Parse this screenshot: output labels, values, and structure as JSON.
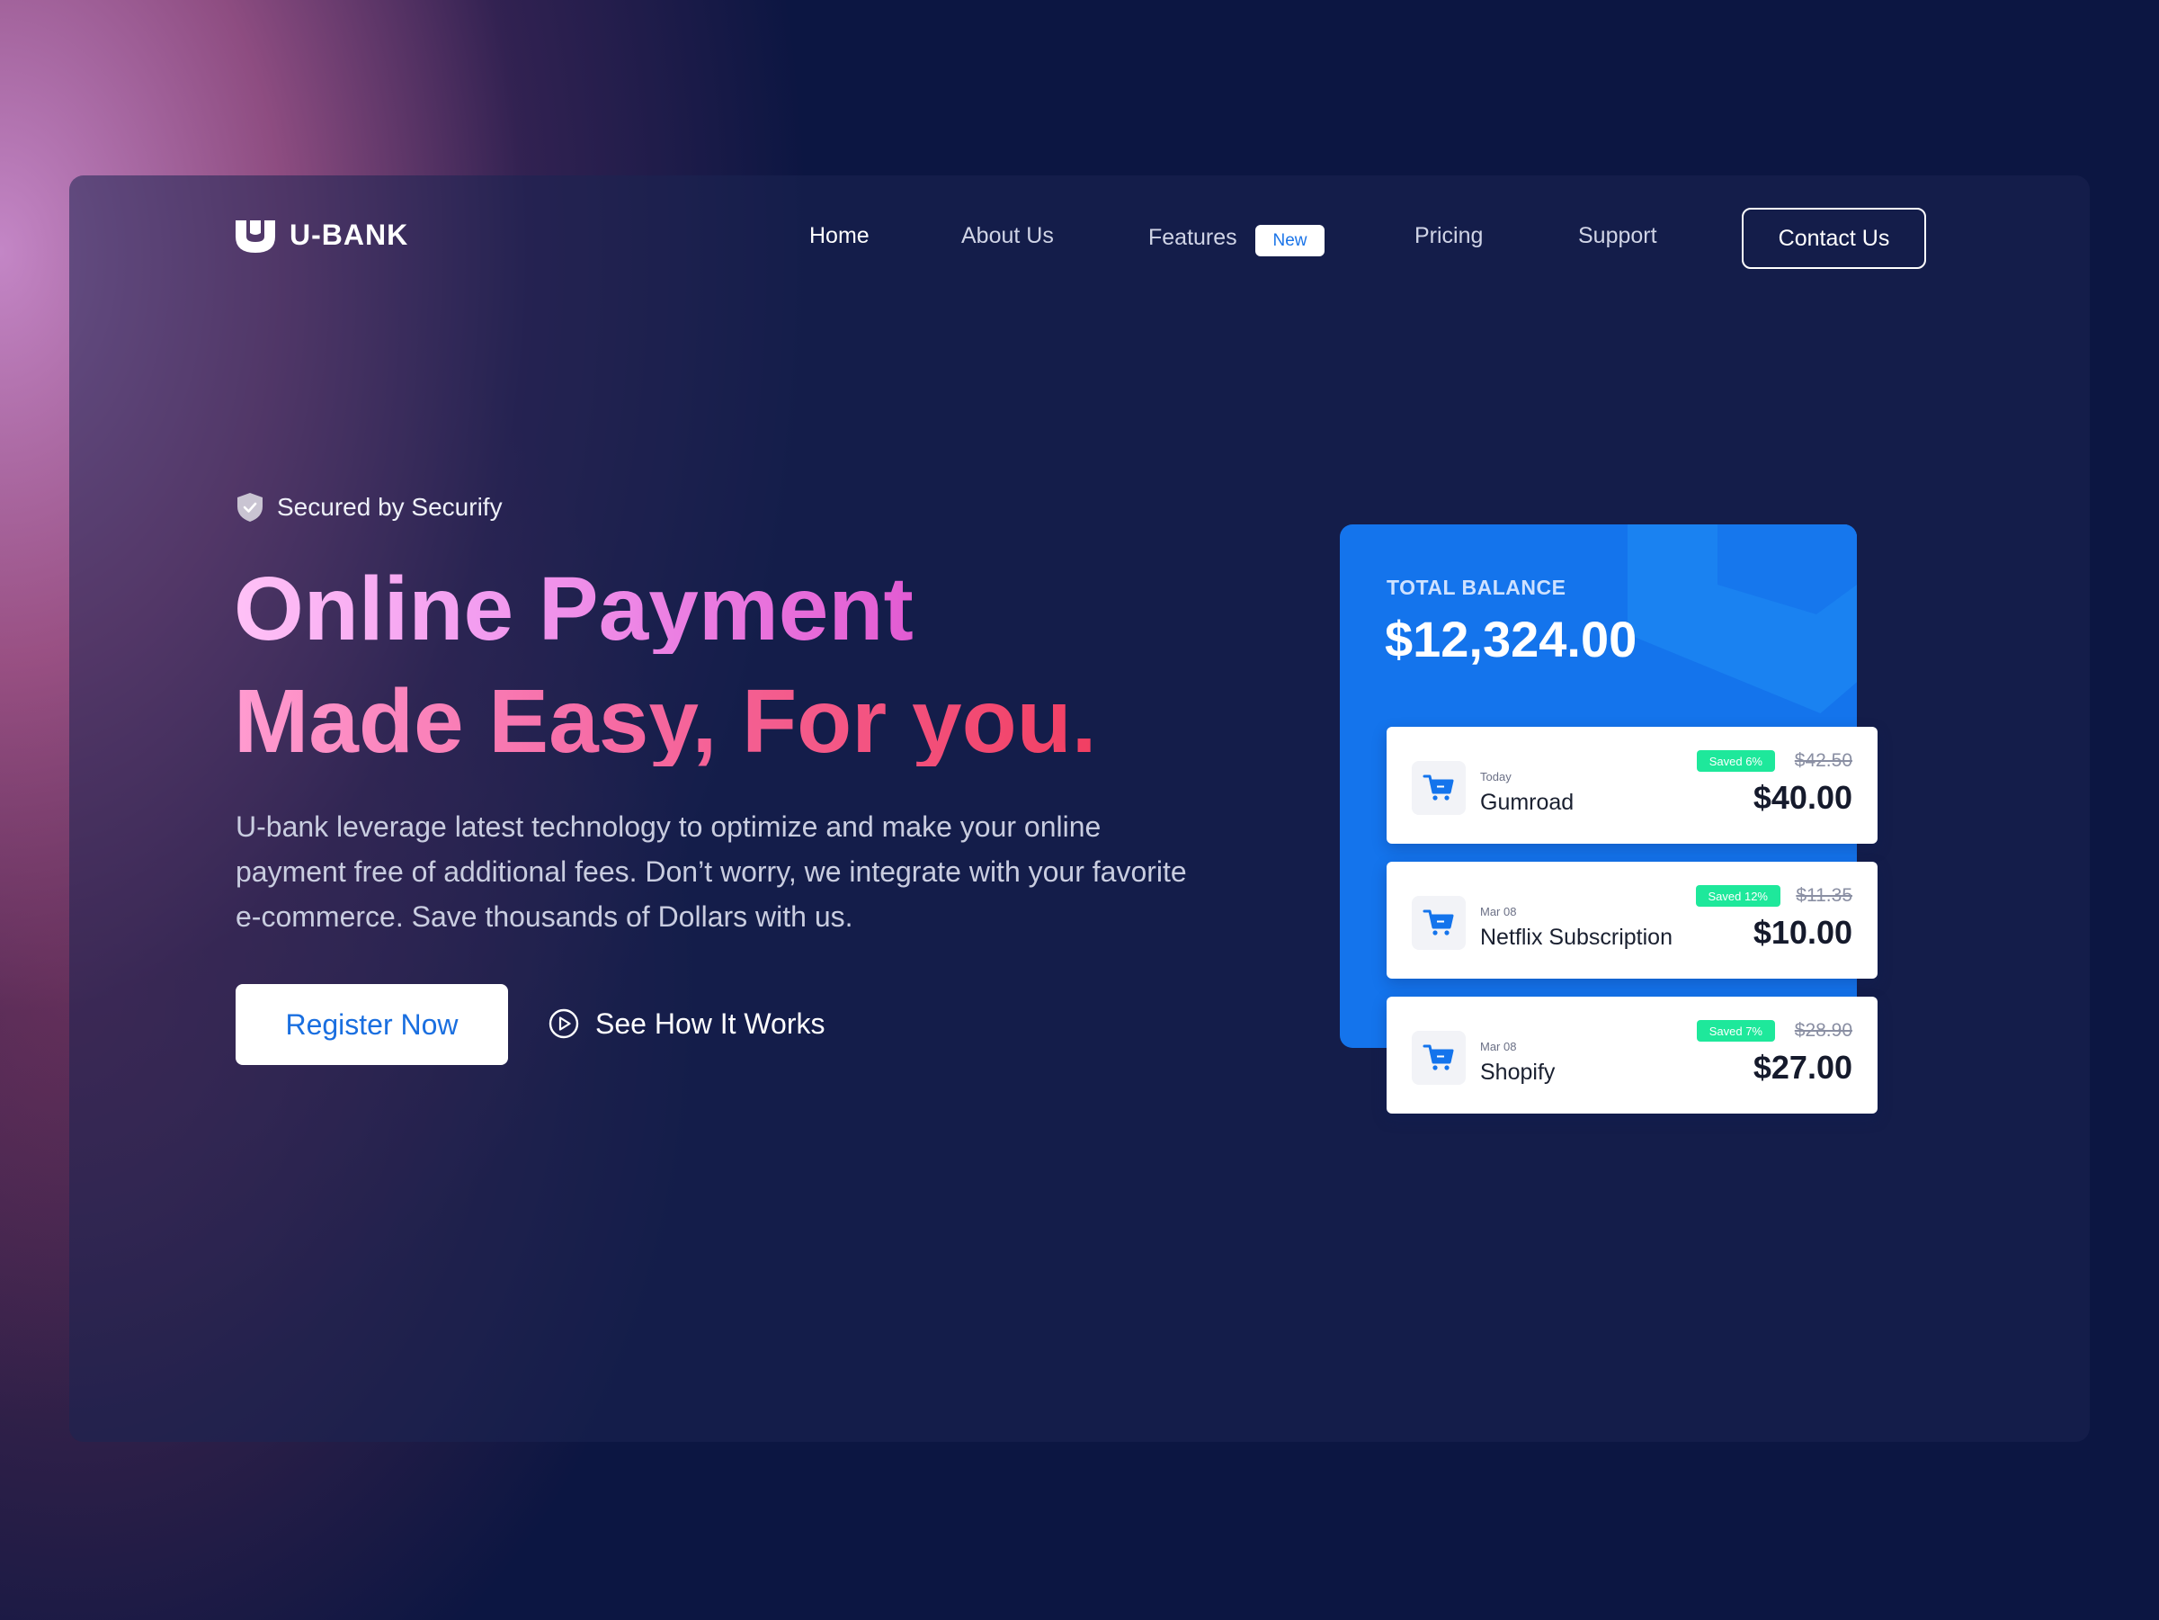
{
  "brand": {
    "name": "U-BANK"
  },
  "nav": {
    "items": [
      {
        "label": "Home",
        "active": true
      },
      {
        "label": "About Us"
      },
      {
        "label": "Features",
        "badge": "New"
      },
      {
        "label": "Pricing"
      },
      {
        "label": "Support"
      }
    ],
    "cta_label": "Contact Us"
  },
  "hero": {
    "security_note": "Secured by Securify",
    "headline_line1": "Online Payment",
    "headline_line2": "Made Easy, For you.",
    "description": "U-bank leverage latest technology to optimize and make your online payment free of additional fees. Don’t worry, we integrate with your favorite e-commerce. Save thousands of Dollars with us.",
    "primary_button": "Register Now",
    "secondary_button": "See How It Works"
  },
  "balance": {
    "label": "TOTAL BALANCE",
    "amount": "$12,324.00"
  },
  "transactions": [
    {
      "date": "Today",
      "name": "Gumroad",
      "badge": "Saved 6%",
      "old_price": "$42.50",
      "price": "$40.00"
    },
    {
      "date": "Mar 08",
      "name": "Netflix Subscription",
      "badge": "Saved 12%",
      "old_price": "$11.35",
      "price": "$10.00"
    },
    {
      "date": "Mar 08",
      "name": "Shopify",
      "badge": "Saved 7%",
      "old_price": "$28.90",
      "price": "$27.00"
    }
  ],
  "colors": {
    "page_bg": "#0c1642",
    "accent_blue": "#1474ec",
    "saved_badge": "#1ee89b",
    "headline_pink": "#f13f62"
  },
  "icons": {
    "logo": "u-shield-logo-icon",
    "security": "shield-check-icon",
    "play": "play-circle-icon",
    "transaction": "shopping-cart-icon"
  }
}
